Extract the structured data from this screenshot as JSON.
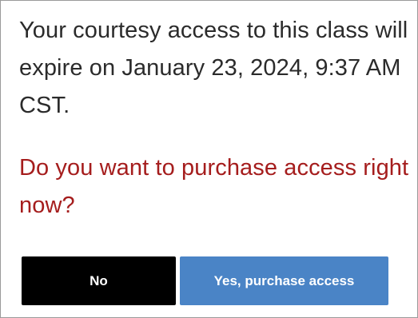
{
  "dialog": {
    "message": "Your courtesy access to this class will expire on January 23, 2024, 9:37 AM CST.",
    "question": "Do you want to purchase access right now?",
    "buttons": {
      "no_label": "No",
      "yes_label": "Yes, purchase access"
    }
  },
  "colors": {
    "question_text": "#a51d1d",
    "no_button_bg": "#000000",
    "yes_button_bg": "#4a84c6"
  }
}
